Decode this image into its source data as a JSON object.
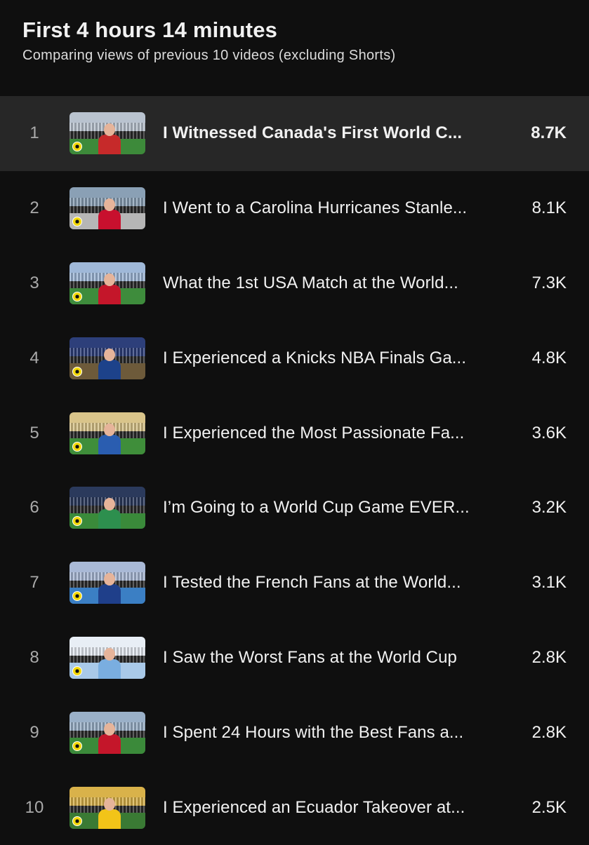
{
  "header": {
    "title": "First 4 hours 14 minutes",
    "subtitle": "Comparing views of previous 10 videos (excluding Shorts)"
  },
  "videos": [
    {
      "rank": "1",
      "title": "I Witnessed Canada's First World C...",
      "views": "8.7K",
      "selected": true,
      "thumb": {
        "sky": "#b9c3cf",
        "field": "#3d8a3a",
        "shirt": "#c62a2a"
      }
    },
    {
      "rank": "2",
      "title": "I Went to a Carolina Hurricanes Stanle...",
      "views": "8.1K",
      "selected": false,
      "thumb": {
        "sky": "#8aa0b5",
        "field": "#b6b6b6",
        "shirt": "#c8102e"
      }
    },
    {
      "rank": "3",
      "title": "What the 1st USA Match at the World...",
      "views": "7.3K",
      "selected": false,
      "thumb": {
        "sky": "#9fb8d8",
        "field": "#3e8c3c",
        "shirt": "#c4162a"
      }
    },
    {
      "rank": "4",
      "title": "I Experienced a Knicks NBA Finals Ga...",
      "views": "4.8K",
      "selected": false,
      "thumb": {
        "sky": "#2d3f7a",
        "field": "#6d5a3a",
        "shirt": "#1d428a"
      }
    },
    {
      "rank": "5",
      "title": "I Experienced the Most Passionate Fa...",
      "views": "3.6K",
      "selected": false,
      "thumb": {
        "sky": "#d9c48a",
        "field": "#3f8e3a",
        "shirt": "#2a5db0"
      }
    },
    {
      "rank": "6",
      "title": "I’m Going to a World Cup Game EVER...",
      "views": "3.2K",
      "selected": false,
      "thumb": {
        "sky": "#2b3a5c",
        "field": "#3a8a3a",
        "shirt": "#2d8f4e"
      }
    },
    {
      "rank": "7",
      "title": "I Tested the French Fans at the World...",
      "views": "3.1K",
      "selected": false,
      "thumb": {
        "sky": "#a9b9d6",
        "field": "#3b7fc4",
        "shirt": "#1f3f8a"
      }
    },
    {
      "rank": "8",
      "title": "I Saw the Worst Fans at the World Cup",
      "views": "2.8K",
      "selected": false,
      "thumb": {
        "sky": "#e8eef5",
        "field": "#a9c9e8",
        "shirt": "#7aaee0"
      }
    },
    {
      "rank": "9",
      "title": "I Spent 24 Hours with the Best Fans a...",
      "views": "2.8K",
      "selected": false,
      "thumb": {
        "sky": "#9ab0c8",
        "field": "#3b8a3a",
        "shirt": "#c4162a"
      }
    },
    {
      "rank": "10",
      "title": "I Experienced an Ecuador Takeover at...",
      "views": "2.5K",
      "selected": false,
      "thumb": {
        "sky": "#d9b24a",
        "field": "#3a7a34",
        "shirt": "#f2c418"
      }
    }
  ]
}
